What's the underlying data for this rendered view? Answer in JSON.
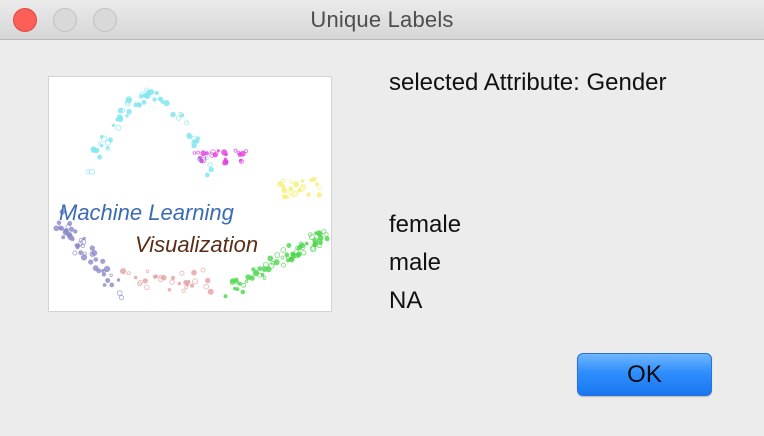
{
  "window": {
    "title": "Unique Labels"
  },
  "logo": {
    "line1": "Machine Learning",
    "line2": "Visualization"
  },
  "attribute": {
    "text": "selected Attribute: Gender"
  },
  "labels": [
    "female",
    "male",
    "NA"
  ],
  "buttons": {
    "ok_label": "OK"
  },
  "colors": {
    "close": "#fc5f57",
    "accent": "#2f8efd"
  }
}
